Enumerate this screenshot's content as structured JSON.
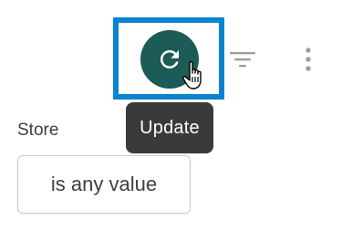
{
  "toolbar": {
    "refresh_button": {
      "icon": "refresh-icon",
      "color": "#1c5b56",
      "highlight_color": "#0a84cf"
    },
    "filter_button": {
      "icon": "filter-icon"
    },
    "more_button": {
      "icon": "more-vert-icon"
    },
    "tooltip": "Update"
  },
  "filter": {
    "label": "Store",
    "value": "is any value"
  }
}
